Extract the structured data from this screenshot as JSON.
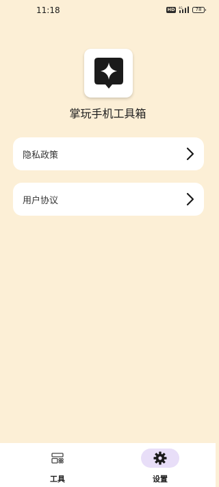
{
  "status_bar": {
    "time": "11:18",
    "hd_badge": "HD",
    "network_label": "4G",
    "battery_level": "78"
  },
  "app": {
    "name": "掌玩手机工具箱",
    "icon": "sparkle-badge-icon"
  },
  "menu": {
    "items": [
      {
        "label": "隐私政策",
        "icon": "chevron-right-icon"
      },
      {
        "label": "用户协议",
        "icon": "chevron-right-icon"
      }
    ]
  },
  "bottom_nav": {
    "items": [
      {
        "label": "工具",
        "icon": "tools-icon",
        "active": false
      },
      {
        "label": "设置",
        "icon": "gear-icon",
        "active": true
      }
    ]
  },
  "colors": {
    "background": "#fcefd6",
    "card": "#ffffff",
    "active_nav_pill": "#e8def8",
    "text": "#1e1e1e"
  }
}
